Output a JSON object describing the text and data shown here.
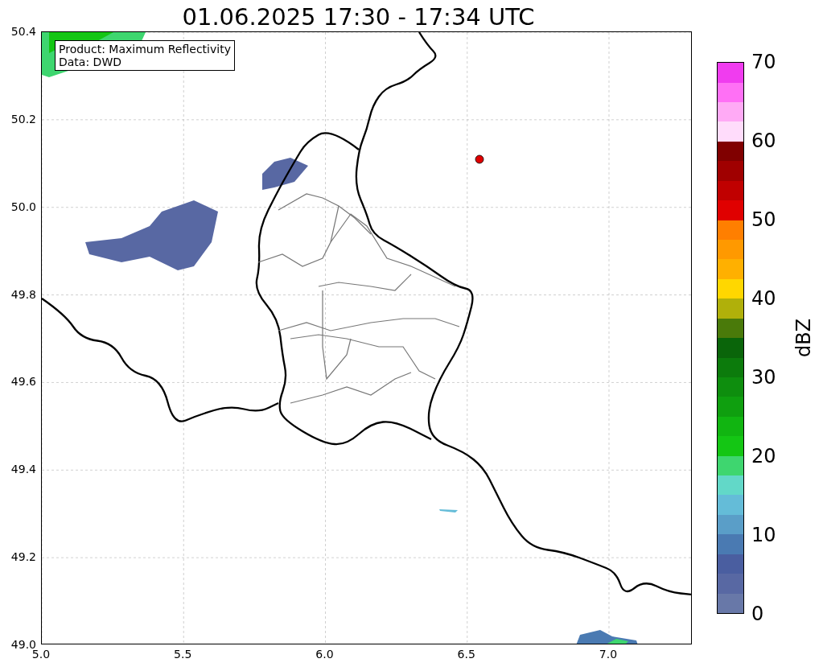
{
  "title": "01.06.2025 17:30 - 17:34 UTC",
  "legend": [
    "Product: Maximum Reflectivity",
    "Data: DWD"
  ],
  "x_ticks": [
    "5.0",
    "5.5",
    "6.0",
    "6.5",
    "7.0"
  ],
  "y_ticks": [
    "50.4",
    "50.2",
    "50.0",
    "49.8",
    "49.6",
    "49.4",
    "49.2",
    "49.0"
  ],
  "colorbar": {
    "label": "dBZ",
    "ticks": [
      "70",
      "60",
      "50",
      "40",
      "30",
      "20",
      "10",
      "0"
    ],
    "bands": [
      {
        "color": "#6878a8"
      },
      {
        "color": "#5868a3"
      },
      {
        "color": "#4a5ea0"
      },
      {
        "color": "#4a7ab2"
      },
      {
        "color": "#5a9ec8"
      },
      {
        "color": "#64bcd8"
      },
      {
        "color": "#62d8c8"
      },
      {
        "color": "#3ed66f"
      },
      {
        "color": "#14c614"
      },
      {
        "color": "#11b511"
      },
      {
        "color": "#0f9f0f"
      },
      {
        "color": "#0e8e0e"
      },
      {
        "color": "#0c7b0c"
      },
      {
        "color": "#0a650a"
      },
      {
        "color": "#4a7a0a"
      },
      {
        "color": "#b0b00a"
      },
      {
        "color": "#ffd700"
      },
      {
        "color": "#ffb000"
      },
      {
        "color": "#ff9900"
      },
      {
        "color": "#ff7f00"
      },
      {
        "color": "#e00000"
      },
      {
        "color": "#c00000"
      },
      {
        "color": "#a00000"
      },
      {
        "color": "#800000"
      },
      {
        "color": "#ffdcfb"
      },
      {
        "color": "#ffaaf5"
      },
      {
        "color": "#ff70f5"
      },
      {
        "color": "#f03cef"
      }
    ]
  }
}
